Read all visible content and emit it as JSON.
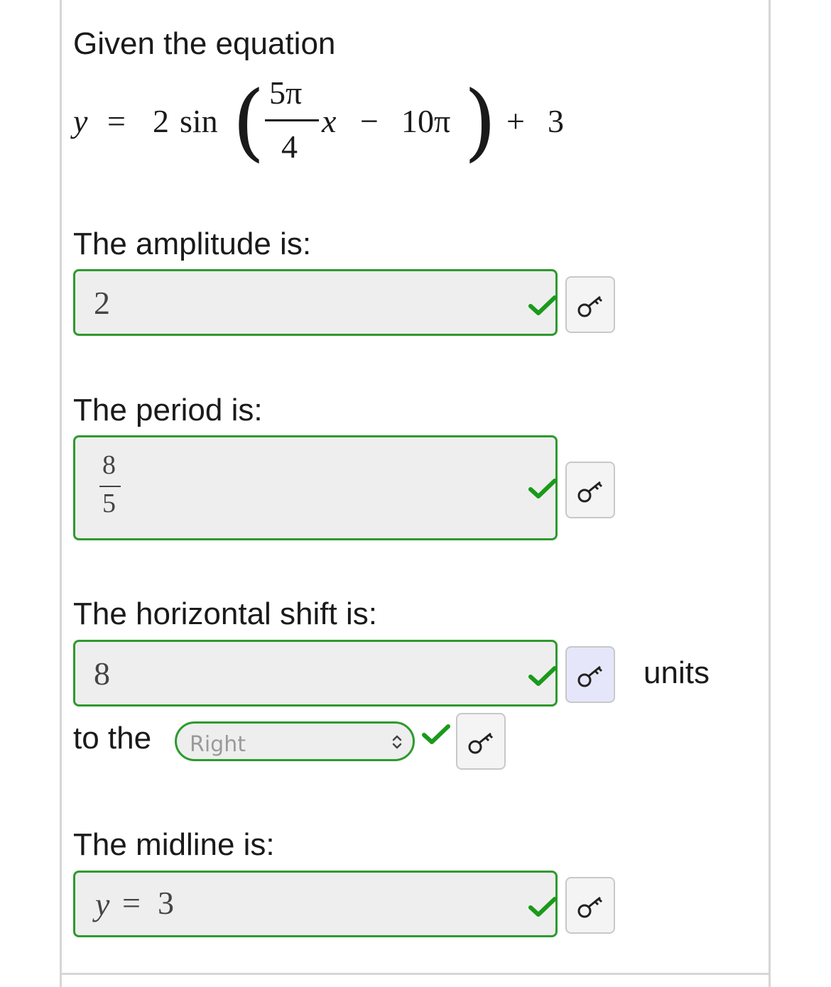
{
  "question": {
    "intro": "Given the equation",
    "equation": {
      "lhs": "y",
      "equals": "=",
      "coef": "2",
      "func": "sin",
      "frac_num": "5π",
      "frac_den": "4",
      "var": "x",
      "minus": "−",
      "shift": "10π",
      "plus": "+",
      "constant": "3"
    }
  },
  "fields": {
    "amplitude": {
      "label": "The amplitude is:",
      "value": "2"
    },
    "period": {
      "label": "The period is:",
      "numerator": "8",
      "denominator": "5"
    },
    "horizontal_shift": {
      "label": "The horizontal shift is:",
      "value": "8",
      "units": "units"
    },
    "direction": {
      "prefix": "to the",
      "selected": "Right"
    },
    "midline": {
      "label": "The midline is:",
      "lhs": "y",
      "equals": "=",
      "value": "3"
    }
  },
  "colors": {
    "correct": "#2e9a2e",
    "check": "#1a9a1a",
    "key_highlight": "#e6e6fb"
  },
  "icons": {
    "check": "check-icon",
    "key": "key-icon",
    "select": "up-down-chevron-icon"
  }
}
